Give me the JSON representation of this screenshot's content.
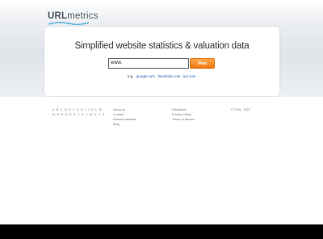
{
  "logo": {
    "part1": "URL",
    "part2": "metrics"
  },
  "headline": "Simplified website statistics & valuation data",
  "search": {
    "value": "www.",
    "button_label": "View"
  },
  "examples": {
    "prefix": "e.g.",
    "links": [
      "google.com",
      "facebook.com",
      "aol.com"
    ]
  },
  "footer": {
    "alphabet_line1": "A B C D E F G H I J K L M",
    "alphabet_line2": "N O P Q R S T U V W X Y Z",
    "col_a": [
      "About us",
      "Contact",
      "Remove website",
      "Blog"
    ],
    "col_b": [
      "Disclaimer",
      "Privacy Policy",
      "Terms of Service"
    ],
    "copyright": "© 2015 - 2021"
  },
  "colors": {
    "accent": "#f07a14",
    "link": "#1d57b4",
    "bottom_bar": "#000000"
  }
}
